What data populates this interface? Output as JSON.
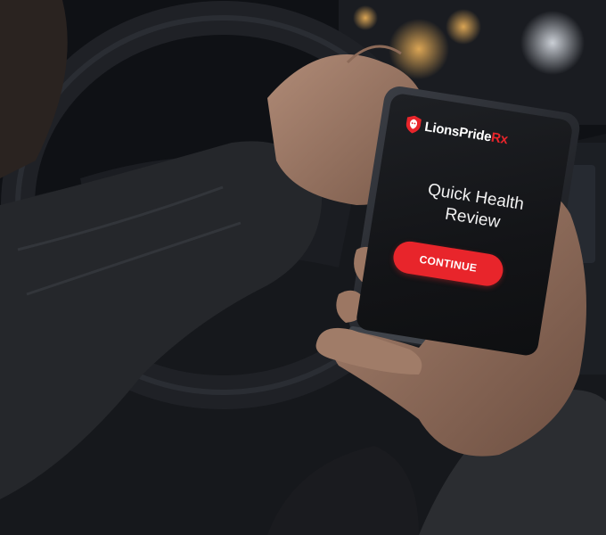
{
  "brand": {
    "name_main": "LionsPride",
    "name_suffix": "Rx",
    "icon": "lion-head-shield-icon"
  },
  "screen": {
    "headline": "Quick Health Review",
    "cta_label": "CONTINUE"
  },
  "colors": {
    "accent": "#e8252b",
    "screen_bg": "#141518",
    "text": "#ffffff"
  }
}
